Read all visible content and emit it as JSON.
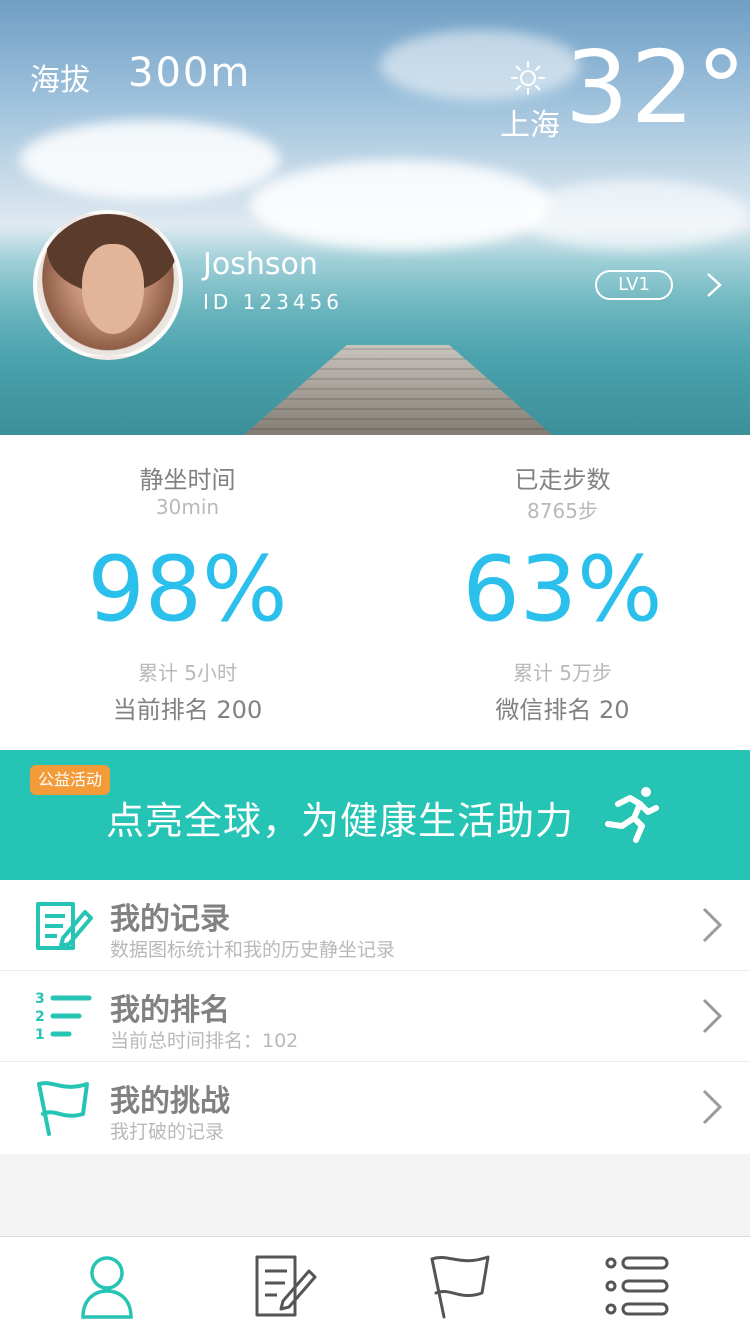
{
  "header": {
    "altitude_label": "海拔",
    "altitude_value": "300m",
    "city": "上海",
    "temperature": "32°",
    "weather_icon": "sun-icon"
  },
  "profile": {
    "username": "Joshson",
    "user_id": "ID 123456",
    "level": "LV1"
  },
  "stats": {
    "sitting": {
      "title": "静坐时间",
      "sub": "30min",
      "percent": "98%",
      "total": "累计 5小时",
      "rank": "当前排名 200"
    },
    "steps": {
      "title": "已走步数",
      "sub": "8765步",
      "percent": "63%",
      "total": "累计 5万步",
      "rank": "微信排名 20"
    }
  },
  "banner": {
    "tag": "公益活动",
    "text": "点亮全球，为健康生活助力",
    "icon": "runner-icon"
  },
  "menu": {
    "items": [
      {
        "title": "我的记录",
        "sub": "数据图标统计和我的历史静坐记录",
        "icon": "record-icon"
      },
      {
        "title": "我的排名",
        "sub": "当前总时间排名：102",
        "icon": "ranking-icon"
      },
      {
        "title": "我的挑战",
        "sub": "我打破的记录",
        "icon": "flag-icon"
      }
    ]
  },
  "tabbar": {
    "tabs": [
      {
        "name": "profile",
        "icon": "user-icon",
        "active": true
      },
      {
        "name": "records",
        "icon": "record-icon"
      },
      {
        "name": "challenges",
        "icon": "flag-icon"
      },
      {
        "name": "list",
        "icon": "list-icon"
      }
    ]
  },
  "colors": {
    "accent_blue": "#2BC0EB",
    "teal": "#26C4B4",
    "orange_tag": "#F29B38",
    "gray_text": "#818181",
    "light_gray_text": "#B9B9B9"
  }
}
